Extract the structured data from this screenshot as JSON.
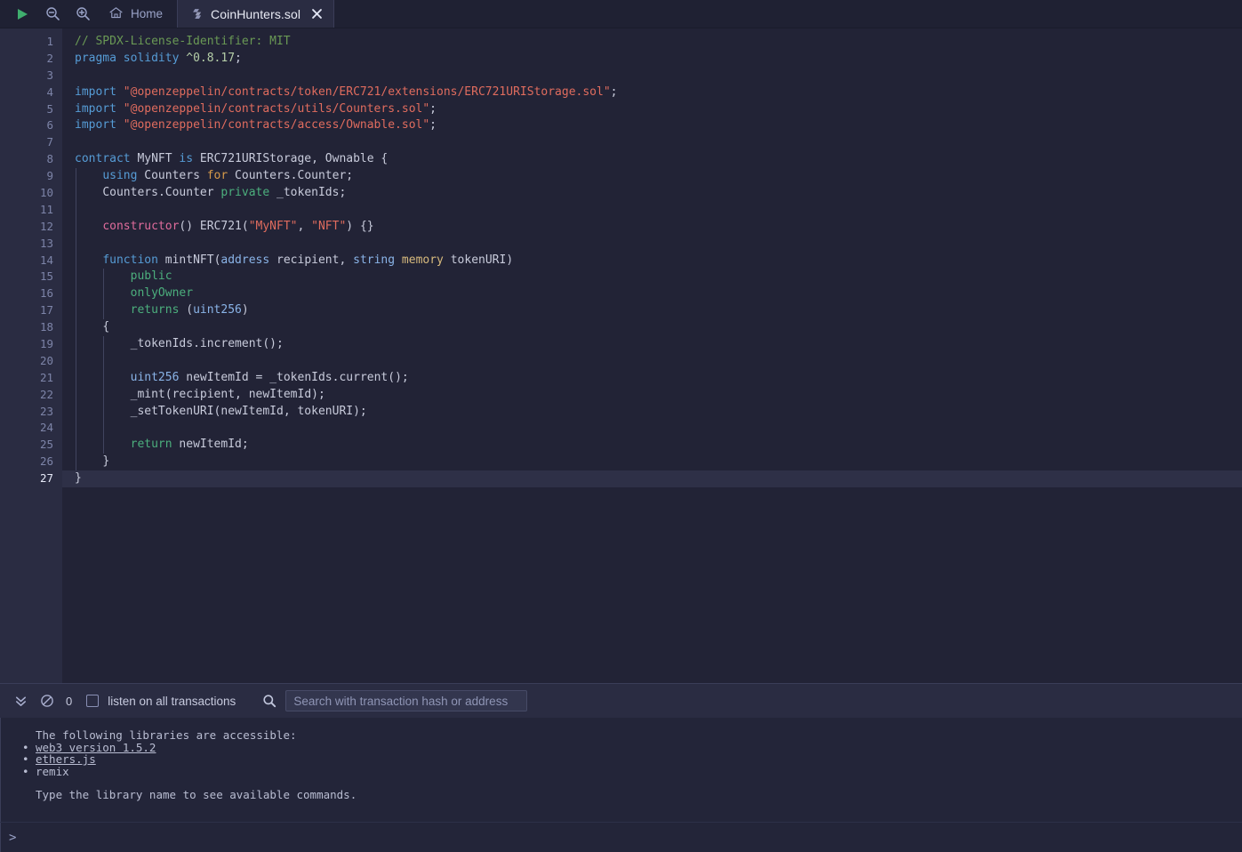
{
  "topbar": {
    "run_icon": "play-icon",
    "zoom_out_icon": "zoom-out-icon",
    "zoom_in_icon": "zoom-in-icon",
    "home_label": "Home",
    "home_icon": "home-icon",
    "tab": {
      "label": "CoinHunters.sol",
      "file_icon": "solidity-icon",
      "close_icon": "close-icon"
    }
  },
  "editor": {
    "active_line": 27,
    "line_numbers": [
      1,
      2,
      3,
      4,
      5,
      6,
      7,
      8,
      9,
      10,
      11,
      12,
      13,
      14,
      15,
      16,
      17,
      18,
      19,
      20,
      21,
      22,
      23,
      24,
      25,
      26,
      27
    ],
    "lines": [
      {
        "n": 1,
        "text": "// SPDX-License-Identifier: MIT"
      },
      {
        "n": 2,
        "text": "pragma solidity ^0.8.17;"
      },
      {
        "n": 3,
        "text": ""
      },
      {
        "n": 4,
        "text": "import \"@openzeppelin/contracts/token/ERC721/extensions/ERC721URIStorage.sol\";"
      },
      {
        "n": 5,
        "text": "import \"@openzeppelin/contracts/utils/Counters.sol\";"
      },
      {
        "n": 6,
        "text": "import \"@openzeppelin/contracts/access/Ownable.sol\";"
      },
      {
        "n": 7,
        "text": ""
      },
      {
        "n": 8,
        "text": "contract MyNFT is ERC721URIStorage, Ownable {"
      },
      {
        "n": 9,
        "text": "    using Counters for Counters.Counter;"
      },
      {
        "n": 10,
        "text": "    Counters.Counter private _tokenIds;"
      },
      {
        "n": 11,
        "text": ""
      },
      {
        "n": 12,
        "text": "    constructor() ERC721(\"MyNFT\", \"NFT\") {}"
      },
      {
        "n": 13,
        "text": ""
      },
      {
        "n": 14,
        "text": "    function mintNFT(address recipient, string memory tokenURI)"
      },
      {
        "n": 15,
        "text": "        public"
      },
      {
        "n": 16,
        "text": "        onlyOwner"
      },
      {
        "n": 17,
        "text": "        returns (uint256)"
      },
      {
        "n": 18,
        "text": "    {"
      },
      {
        "n": 19,
        "text": "        _tokenIds.increment();"
      },
      {
        "n": 20,
        "text": ""
      },
      {
        "n": 21,
        "text": "        uint256 newItemId = _tokenIds.current();"
      },
      {
        "n": 22,
        "text": "        _mint(recipient, newItemId);"
      },
      {
        "n": 23,
        "text": "        _setTokenURI(newItemId, tokenURI);"
      },
      {
        "n": 24,
        "text": ""
      },
      {
        "n": 25,
        "text": "        return newItemId;"
      },
      {
        "n": 26,
        "text": "    }"
      },
      {
        "n": 27,
        "text": "}"
      }
    ]
  },
  "terminal": {
    "toolbar": {
      "collapse_icon": "double-chevron-down-icon",
      "clear_icon": "no-entry-icon",
      "count": "0",
      "listen_checkbox_checked": false,
      "listen_label": "listen on all transactions",
      "search_icon": "search-icon",
      "search_value": "",
      "search_placeholder": "Search with transaction hash or address"
    },
    "output": {
      "heading": "The following libraries are accessible:",
      "items": [
        {
          "text": "web3 version 1.5.2",
          "link": true
        },
        {
          "text": "ethers.js",
          "link": true
        },
        {
          "text": "remix",
          "link": false
        }
      ],
      "footer": "Type the library name to see available commands."
    },
    "prompt_symbol": ">"
  },
  "colors": {
    "editor_bg": "#222336",
    "gutter_bg": "#2a2c42",
    "topbar_bg": "#1f2133",
    "terminal_bg": "#232539",
    "accent_green": "#3fae6e",
    "comment": "#6a9955",
    "keyword": "#569cd6",
    "string": "#e06c5e",
    "number": "#b5cea8",
    "modifier": "#4caf7d",
    "constructor": "#e06c9c",
    "memory": "#d7ba7d",
    "for_keyword": "#d79a4a"
  }
}
